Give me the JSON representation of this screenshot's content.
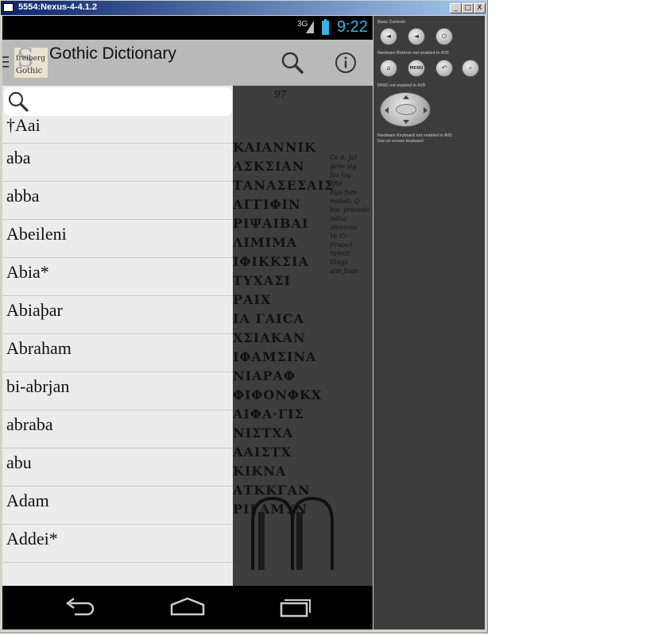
{
  "window": {
    "title": "5554:Nexus-4-4.1.2",
    "controls": {
      "minimize": "_",
      "maximize": "□",
      "close": "X"
    }
  },
  "statusbar": {
    "network": "3G",
    "time": "9:22"
  },
  "actionbar": {
    "logo": {
      "letter": "S",
      "line1": "freiberg",
      "line2": "Gothic"
    },
    "title": "Gothic Dictionary",
    "icons": [
      "search-icon",
      "info-icon"
    ]
  },
  "search": {
    "value": "",
    "placeholder": "",
    "icon": "search-icon"
  },
  "entries": [
    "†Aai",
    "aba",
    "abba",
    "Abeileni",
    "Abia*",
    "Abiaþar",
    "Abraham",
    "bi-abrjan",
    "abraba",
    "abu",
    "Adam",
    "Addei*"
  ],
  "manuscript": {
    "page": "97",
    "lines": [
      "ΚΑΙΑΝΝΙΚ",
      "ΑΣΚΣΙΑΝ",
      "ΤΑΝΑΣΕΣΑΙΣ",
      "ΑΓΓΙΦΙΝ",
      "ΡΙΨΑΙΒΑΙ",
      "ΛΙΜΙΜΑ",
      "ΙΦΙΚΚΣΙΑ",
      "ΤΥΧΑΣΙ",
      "ΡΑΙΧ",
      "ΙΑ ΓΑΙCA",
      "ΧΣΙΑΚΑΝ",
      "ΙΦΑΜΣΙΝΑ",
      "ΝΙΑΡΑΦ",
      "ΦΙΦΟΝΦΚΧ",
      "ΑΙΦΑ·ΓΙΣ",
      "ΝΙΣΤΧΑ",
      "ΑΑΙΣΤΧ",
      "ΚΙΚΝΑ",
      "ΑΤΚΚΓΑΝ",
      "ΡΙΓΑΜΥΝ"
    ],
    "notes": [
      "Ca 8. Jol",
      "gens sig",
      "fas log",
      "ofte",
      "Ego fum",
      "mundi. Q",
      "hoc precede",
      "initia",
      "amussus",
      "Ve Cr",
      "Proced",
      "rofecti",
      "Vings",
      "aim Juan"
    ]
  },
  "navbar": {
    "icons": [
      "back-icon",
      "home-icon",
      "recent-apps-icon"
    ]
  },
  "panel": {
    "basic_controls": "Basic Controls",
    "hardware_buttons": "Hardware Buttons not enabled in AVD",
    "dpad": "DPAD not enabled in AVD",
    "keyboard_line1": "Hardware Keyboard not enabled in AVD",
    "keyboard_line2": "Use on screen keyboard",
    "menu_label": "MENU",
    "basic_icons": [
      "volume-down-icon",
      "volume-up-icon",
      "power-icon"
    ],
    "hw_icons": [
      "home-icon",
      "menu-icon",
      "back-icon",
      "search-icon"
    ]
  },
  "colors": {
    "accent": "#33b5e5",
    "actionbar": "#b9b9b9",
    "drawer": "#ececec",
    "titlebar": "#0a246a"
  }
}
